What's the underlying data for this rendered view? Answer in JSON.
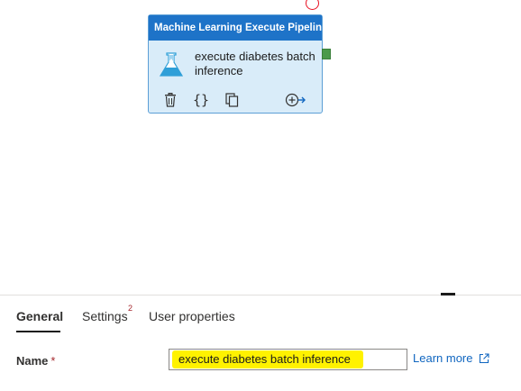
{
  "canvas": {
    "activity": {
      "header": "Machine Learning Execute Pipeline",
      "name": "execute diabetes batch inference",
      "icon": "flask-icon",
      "actions": [
        "delete-icon",
        "code-icon",
        "copy-icon",
        "add-output-icon"
      ]
    },
    "colors": {
      "header": "#1e73c8",
      "card": "#d9ecf9",
      "success": "#4a9a4a",
      "error": "#e81123"
    }
  },
  "tabs": [
    {
      "label": "General",
      "active": true
    },
    {
      "label": "Settings",
      "badge": "2"
    },
    {
      "label": "User properties"
    }
  ],
  "form": {
    "name_label": "Name",
    "required": "*",
    "name_value": "execute diabetes batch inference",
    "learn_more": "Learn more"
  },
  "colors": {
    "highlight": "#fff200",
    "link": "#1066c0"
  }
}
